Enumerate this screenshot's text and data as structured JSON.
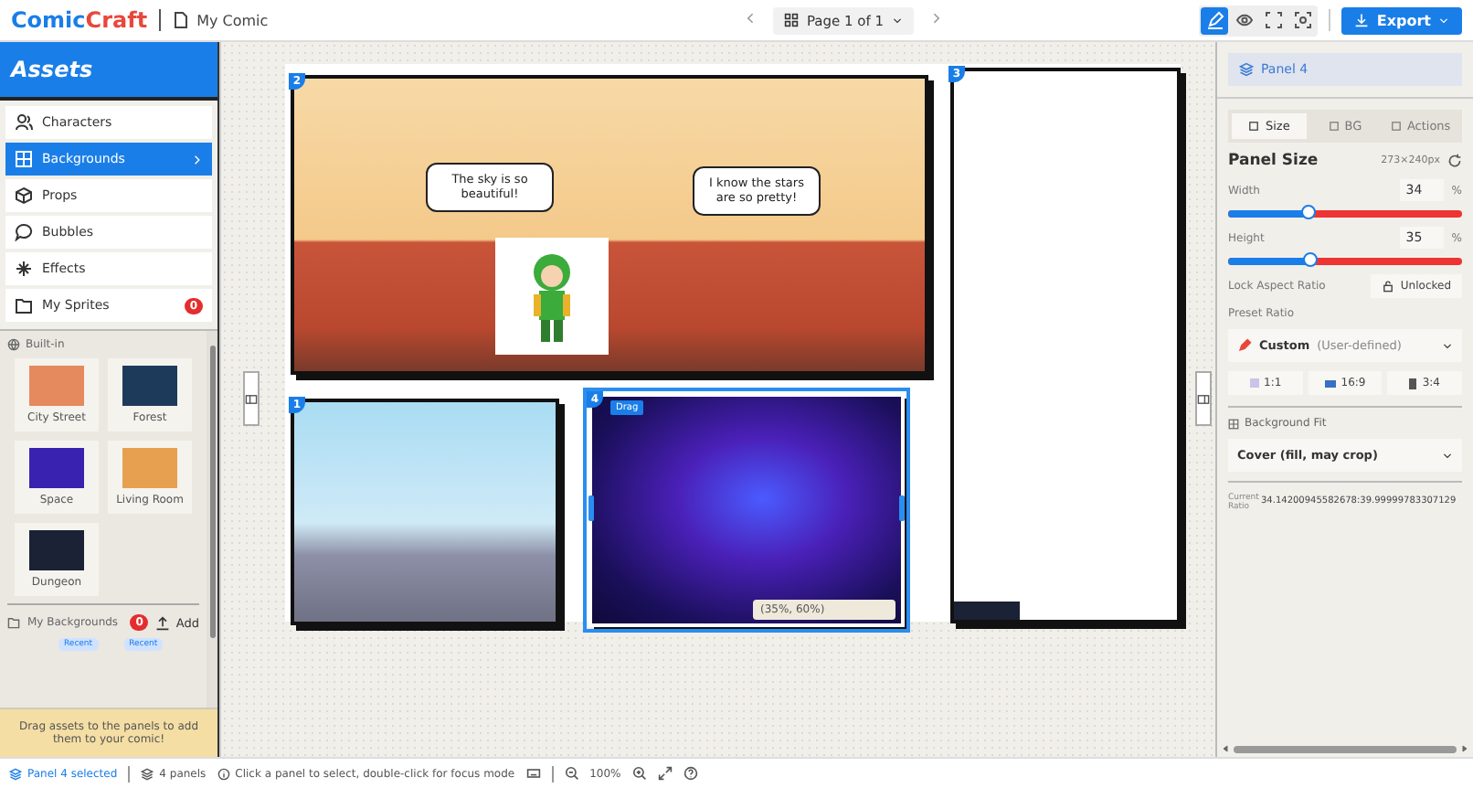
{
  "topbar": {
    "logo": [
      "Comic",
      "Craft"
    ],
    "document": "My Comic",
    "page_selector": "Page 1 of 1",
    "modes": [
      {
        "kind": "edit",
        "selected": true
      },
      {
        "kind": "preview",
        "selected": false
      },
      {
        "kind": "fullscreen",
        "selected": false
      },
      {
        "kind": "focus",
        "selected": false
      }
    ],
    "export": "Export"
  },
  "sidebar": {
    "title": "Assets",
    "items": [
      {
        "label": "Characters",
        "kind": "characters",
        "selected": false
      },
      {
        "label": "Backgrounds",
        "kind": "backgrounds",
        "selected": true
      },
      {
        "label": "Props",
        "kind": "props",
        "selected": false
      },
      {
        "label": "Bubbles",
        "kind": "bubbles",
        "selected": false
      },
      {
        "label": "Effects",
        "kind": "effects",
        "selected": false
      },
      {
        "label": "My Sprites",
        "kind": "sprites",
        "selected": false,
        "badge": "0"
      }
    ],
    "built_in": {
      "title": "Built-in",
      "items": [
        {
          "label": "City Street",
          "color": "#e58a5e"
        },
        {
          "label": "Forest",
          "color": "#1d3a5a"
        },
        {
          "label": "Space",
          "color": "#3a22b0"
        },
        {
          "label": "Living Room",
          "color": "#e7a04f"
        },
        {
          "label": "Dungeon",
          "color": "#1b2236"
        }
      ]
    },
    "my_backgrounds": {
      "title": "My Backgrounds",
      "badge": "0",
      "add": "Add",
      "items": [
        {
          "tag": "Recent"
        },
        {
          "tag": "Recent"
        }
      ]
    },
    "hint": "Drag assets to the panels to add them to your comic!"
  },
  "canvas": {
    "panels": [
      {
        "number": "2",
        "kind": "living-room",
        "selected": false,
        "bubbles": [
          "The sky is so beautiful!",
          "I know the stars are so pretty!"
        ],
        "character": true
      },
      {
        "number": "3",
        "kind": "empty",
        "selected": false
      },
      {
        "number": "1",
        "kind": "city-street",
        "selected": false
      },
      {
        "number": "4",
        "kind": "space",
        "selected": true,
        "drag": "Drag",
        "position": "(35%, 60%)"
      }
    ]
  },
  "inspector": {
    "selection": "Panel 4",
    "tabs": [
      {
        "label": "Size",
        "selected": true
      },
      {
        "label": "BG",
        "selected": false
      },
      {
        "label": "Actions",
        "selected": false
      }
    ],
    "panel_size": {
      "title": "Panel Size",
      "dimensions": "273×240px"
    },
    "sliders": [
      {
        "label": "Width",
        "value": "34",
        "unit": "%",
        "level": 0.34
      },
      {
        "label": "Height",
        "value": "35",
        "unit": "%",
        "level": 0.35
      }
    ],
    "lock": {
      "label": "Lock Aspect Ratio",
      "value": "Unlocked",
      "locked": false
    },
    "preset": {
      "label": "Preset Ratio",
      "value": "Custom",
      "note": "(User-defined)",
      "options": [
        "1:1",
        "16:9",
        "3:4"
      ]
    },
    "fit": {
      "label": "Background Fit",
      "value": "Cover (fill, may crop)"
    },
    "current_ratio": {
      "label": "Current Ratio",
      "value": "34.14200945582678:39.99999783307129"
    }
  },
  "status_bar": {
    "selection": "Panel 4 selected",
    "panels": "4 panels",
    "hint": "Click a panel to select, double-click for focus mode",
    "zoom": "100%"
  }
}
